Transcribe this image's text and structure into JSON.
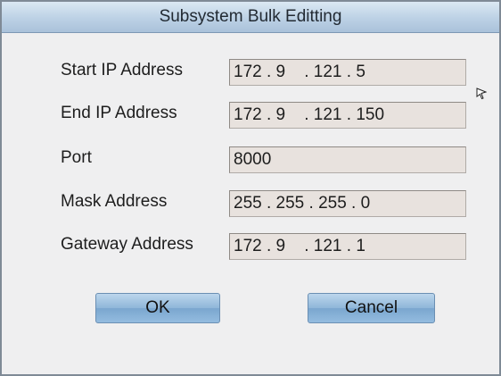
{
  "dialog": {
    "title": "Subsystem Bulk Editting"
  },
  "fields": {
    "start_ip": {
      "label": "Start IP Address",
      "value": "172 . 9    . 121 . 5"
    },
    "end_ip": {
      "label": "End IP Address",
      "value": "172 . 9    . 121 . 150"
    },
    "port": {
      "label": "Port",
      "value": "8000"
    },
    "mask": {
      "label": "Mask Address",
      "value": "255 . 255 . 255 . 0"
    },
    "gateway": {
      "label": "Gateway Address",
      "value": "172 . 9    . 121 . 1"
    }
  },
  "buttons": {
    "ok_label": "OK",
    "cancel_label": "Cancel"
  },
  "colors": {
    "title_bar": "#bcd1e5",
    "field_bg": "#e8e2de",
    "button": "#8fb6d9",
    "dialog_bg": "#efeff0"
  },
  "icons": {
    "cursor": "mouse-pointer-icon"
  }
}
